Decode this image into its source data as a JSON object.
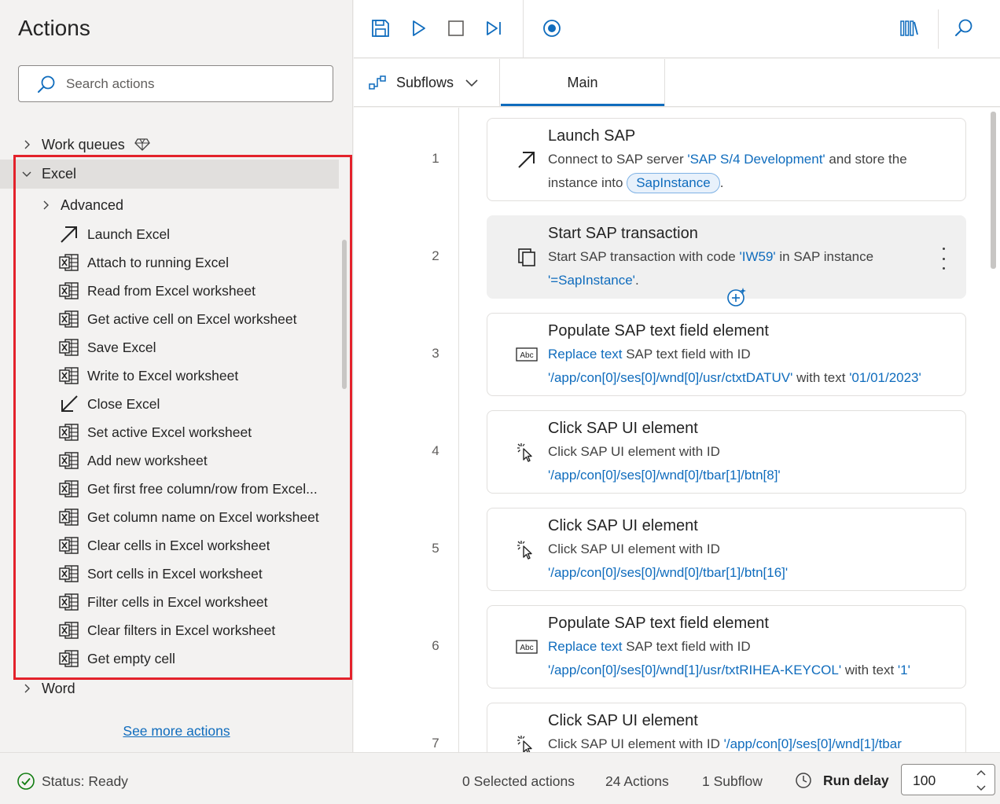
{
  "actions_pane": {
    "title": "Actions",
    "search_placeholder": "Search actions",
    "groups": {
      "work_queues": "Work queues",
      "excel": "Excel",
      "advanced": "Advanced",
      "word": "Word"
    },
    "excel_items": [
      {
        "label": "Launch Excel",
        "icon": "launch-arrow-icon"
      },
      {
        "label": "Attach to running Excel",
        "icon": "excel-icon"
      },
      {
        "label": "Read from Excel worksheet",
        "icon": "excel-icon"
      },
      {
        "label": "Get active cell on Excel worksheet",
        "icon": "excel-icon"
      },
      {
        "label": "Save Excel",
        "icon": "excel-icon"
      },
      {
        "label": "Write to Excel worksheet",
        "icon": "excel-icon"
      },
      {
        "label": "Close Excel",
        "icon": "close-arrow-icon"
      },
      {
        "label": "Set active Excel worksheet",
        "icon": "excel-icon"
      },
      {
        "label": "Add new worksheet",
        "icon": "excel-icon"
      },
      {
        "label": "Get first free column/row from Excel...",
        "icon": "excel-icon"
      },
      {
        "label": "Get column name on Excel worksheet",
        "icon": "excel-icon"
      },
      {
        "label": "Clear cells in Excel worksheet",
        "icon": "excel-icon"
      },
      {
        "label": "Sort cells in Excel worksheet",
        "icon": "excel-icon"
      },
      {
        "label": "Filter cells in Excel worksheet",
        "icon": "excel-icon"
      },
      {
        "label": "Clear filters in Excel worksheet",
        "icon": "excel-icon"
      },
      {
        "label": "Get empty cell",
        "icon": "excel-icon"
      }
    ],
    "see_more": "See more actions"
  },
  "tabs": {
    "subflows": "Subflows",
    "main": "Main"
  },
  "flow": {
    "steps": [
      {
        "num": "1",
        "title": "Launch SAP",
        "icon": "launch-arrow-icon",
        "parts": [
          {
            "t": "Connect to SAP server "
          },
          {
            "t": "'SAP S/4 Development'",
            "v": true
          },
          {
            "t": " and store the instance into "
          },
          {
            "t": "SapInstance",
            "pill": true
          },
          {
            "t": "."
          }
        ]
      },
      {
        "num": "2",
        "title": "Start SAP transaction",
        "icon": "transaction-icon",
        "selected": true,
        "parts": [
          {
            "t": "Start SAP transaction with code "
          },
          {
            "t": "'IW59'",
            "v": true
          },
          {
            "t": " in SAP instance "
          },
          {
            "t": "'=SapInstance'",
            "v": true
          },
          {
            "t": "."
          }
        ]
      },
      {
        "num": "3",
        "title": "Populate SAP text field element",
        "icon": "text-field-icon",
        "parts": [
          {
            "t": "Replace text",
            "v": true
          },
          {
            "t": " SAP text field with ID "
          },
          {
            "t": "'/app/con[0]/ses[0]/wnd[0]/usr/ctxtDATUV'",
            "v": true
          },
          {
            "t": " with text "
          },
          {
            "t": "'01/01/2023'",
            "v": true
          }
        ]
      },
      {
        "num": "4",
        "title": "Click SAP UI element",
        "icon": "click-icon",
        "parts": [
          {
            "t": "Click SAP UI element with ID "
          },
          {
            "t": "'/app/con[0]/ses[0]/wnd[0]/tbar[1]/btn[8]'",
            "v": true
          }
        ]
      },
      {
        "num": "5",
        "title": "Click SAP UI element",
        "icon": "click-icon",
        "parts": [
          {
            "t": "Click SAP UI element with ID "
          },
          {
            "t": "'/app/con[0]/ses[0]/wnd[0]/tbar[1]/btn[16]'",
            "v": true
          }
        ]
      },
      {
        "num": "6",
        "title": "Populate SAP text field element",
        "icon": "text-field-icon",
        "parts": [
          {
            "t": "Replace text",
            "v": true
          },
          {
            "t": " SAP text field with ID "
          },
          {
            "t": "'/app/con[0]/ses[0]/wnd[1]/usr/txtRIHEA-KEYCOL'",
            "v": true
          },
          {
            "t": " with text "
          },
          {
            "t": "'1'",
            "v": true
          }
        ]
      },
      {
        "num": "7",
        "title": "Click SAP UI element",
        "icon": "click-icon",
        "parts": [
          {
            "t": "Click SAP UI element with ID "
          },
          {
            "t": "'/app/con[0]/ses[0]/wnd[1]/tbar",
            "v": true
          }
        ]
      }
    ]
  },
  "status_bar": {
    "status": "Status: Ready",
    "selected": "0 Selected actions",
    "actions": "24 Actions",
    "subflows": "1 Subflow",
    "run_delay_label": "Run delay",
    "run_delay_value": "100"
  },
  "colors": {
    "accent": "#0f6cbd",
    "highlight": "#e3222b",
    "status_ok": "#107c10"
  }
}
